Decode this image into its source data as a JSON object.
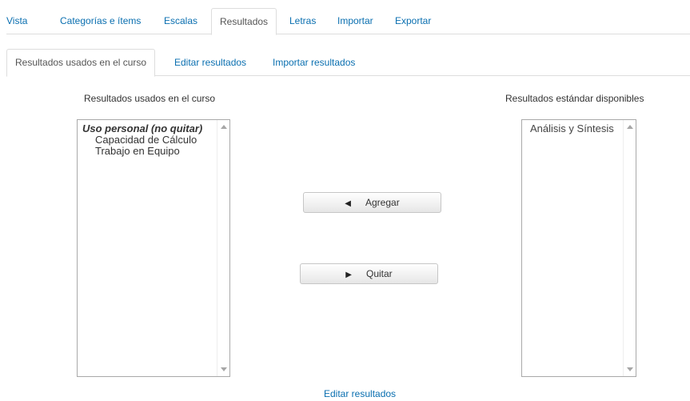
{
  "top_tabs": [
    {
      "label": "Vista"
    },
    {
      "label": "Categorías e ítems"
    },
    {
      "label": "Escalas"
    },
    {
      "label": "Resultados",
      "active": true
    },
    {
      "label": "Letras"
    },
    {
      "label": "Importar"
    },
    {
      "label": "Exportar"
    }
  ],
  "sub_tabs": [
    {
      "label": "Resultados usados en el curso",
      "active": true
    },
    {
      "label": "Editar resultados"
    },
    {
      "label": "Importar resultados"
    }
  ],
  "left_panel": {
    "title": "Resultados usados en el curso",
    "group_label": "Uso personal (no quitar)",
    "items": [
      "Capacidad de Cálculo",
      "Trabajo en Equipo"
    ]
  },
  "right_panel": {
    "title": "Resultados estándar disponibles",
    "items": [
      "Análisis y Síntesis"
    ]
  },
  "buttons": {
    "add_label": "Agregar",
    "add_glyph": "◀",
    "remove_label": "Quitar",
    "remove_glyph": "▶"
  },
  "footer": {
    "link_label": "Editar resultados"
  },
  "colors": {
    "link": "#0a6fb0",
    "border": "#dddddd"
  },
  "icons": {
    "scroll_up": "chevron-up-icon",
    "scroll_down": "chevron-down-icon"
  }
}
